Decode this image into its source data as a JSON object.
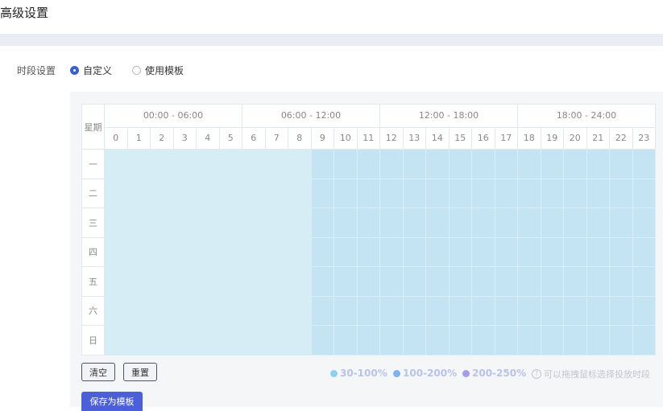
{
  "page": {
    "title": "高级设置"
  },
  "time_setting": {
    "label": "时段设置",
    "options": [
      {
        "label": "自定义",
        "checked": true
      },
      {
        "label": "使用模板",
        "checked": false
      }
    ]
  },
  "schedule": {
    "week_header": "星期",
    "ranges": [
      "00:00 - 06:00",
      "06:00 - 12:00",
      "12:00 - 18:00",
      "18:00 - 24:00"
    ],
    "hours": [
      "0",
      "1",
      "2",
      "3",
      "4",
      "5",
      "6",
      "7",
      "8",
      "9",
      "10",
      "11",
      "12",
      "13",
      "14",
      "15",
      "16",
      "17",
      "18",
      "19",
      "20",
      "21",
      "22",
      "23"
    ],
    "days": [
      "一",
      "二",
      "三",
      "四",
      "五",
      "六",
      "日"
    ],
    "selected_from_hour": 9,
    "colors": {
      "unselected": "#d7edf5",
      "selected": "#c4e4f4"
    }
  },
  "actions": {
    "clear_label": "清空",
    "reset_label": "重置",
    "save_template_label": "保存为模板"
  },
  "legend": [
    {
      "label": "30-100%",
      "color": "#8fd0ec"
    },
    {
      "label": "100-200%",
      "color": "#7fb3f0"
    },
    {
      "label": "200-250%",
      "color": "#a79be8"
    }
  ],
  "hint": {
    "icon": "help-circle-icon",
    "text": "可以拖拽鼠标选择投放时段"
  }
}
